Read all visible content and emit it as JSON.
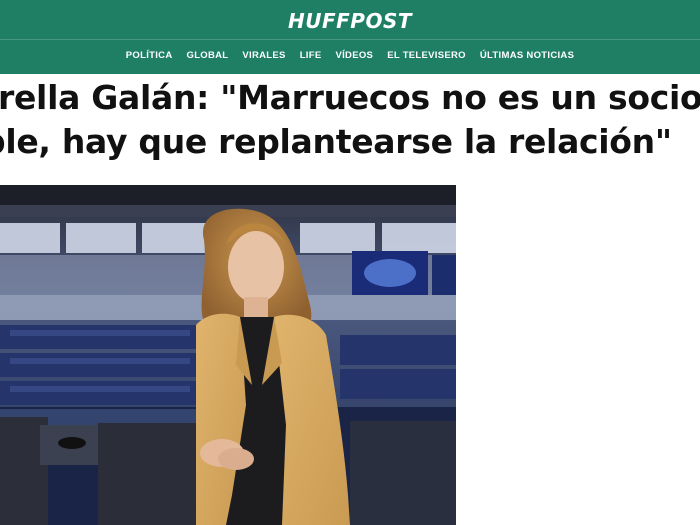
{
  "site": {
    "logo": "HUFFPOST",
    "brand_color": "#1e7f65"
  },
  "nav": {
    "items": [
      {
        "label": "POLÍTICA"
      },
      {
        "label": "GLOBAL"
      },
      {
        "label": "VIRALES"
      },
      {
        "label": "LIFE"
      },
      {
        "label": "VÍDEOS"
      },
      {
        "label": "EL TELEVISERO"
      },
      {
        "label": "ÚLTIMAS NOTICIAS"
      }
    ]
  },
  "article": {
    "headline_line1": "rella Galán: \"Marruecos no es un socio",
    "headline_line2": "ble, hay que replantearse la relación\"",
    "photo_subject": "woman-in-yellow-blazer-parliament-chamber"
  }
}
